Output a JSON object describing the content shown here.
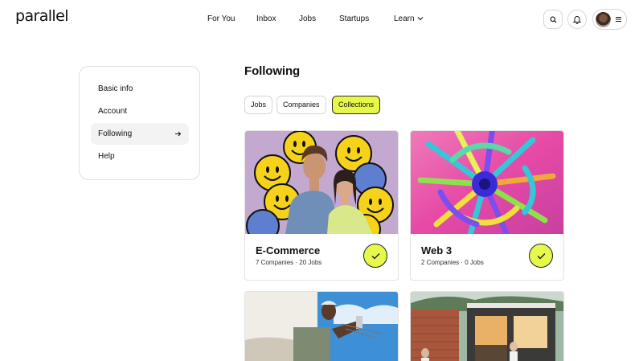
{
  "header": {
    "logo": "parallel",
    "nav": [
      {
        "label": "For You"
      },
      {
        "label": "Inbox"
      },
      {
        "label": "Jobs"
      },
      {
        "label": "Startups"
      },
      {
        "label": "Learn"
      }
    ],
    "icons": {
      "search": "search-icon",
      "notifications": "bell-icon",
      "menu": "hamburger-menu-icon"
    }
  },
  "sidebar": {
    "items": [
      {
        "label": "Basic info",
        "active": false
      },
      {
        "label": "Account",
        "active": false
      },
      {
        "label": "Following",
        "active": true
      },
      {
        "label": "Help",
        "active": false
      }
    ]
  },
  "main": {
    "title": "Following",
    "filters": [
      {
        "label": "Jobs",
        "active": false
      },
      {
        "label": "Companies",
        "active": false
      },
      {
        "label": "Collections",
        "active": true
      }
    ],
    "collections": [
      {
        "title": "E-Commerce",
        "meta": "7 Companies · 20 Jobs",
        "followed": true
      },
      {
        "title": "Web 3",
        "meta": "2 Companies · 0 Jobs",
        "followed": true
      },
      {
        "title": "",
        "meta": "",
        "followed": false
      },
      {
        "title": "",
        "meta": "",
        "followed": false
      }
    ]
  },
  "colors": {
    "accent": "#e6f84a",
    "border": "#e0e0e0",
    "text": "#111111"
  }
}
